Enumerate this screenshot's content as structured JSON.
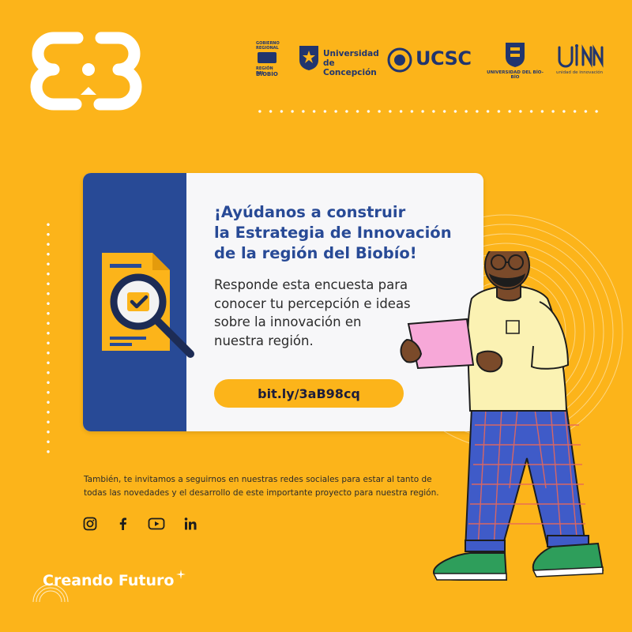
{
  "colors": {
    "background": "#FCB41A",
    "navy": "#284A96",
    "white": "#FFFFFF"
  },
  "partners": {
    "gobierno": {
      "line1": "GOBIERNO",
      "line2": "REGIONAL",
      "line3": "REGIÓN DEL",
      "line4": "BIOBÍO"
    },
    "udec": {
      "line1": "Universidad",
      "line2": "de Concepción"
    },
    "ucsc": {
      "label": "UCSC"
    },
    "ubb": {
      "label": "UNIVERSIDAD DEL BÍO-BÍO"
    },
    "uinn": {
      "label": "unidad de innovación"
    }
  },
  "card": {
    "headline_1": "¡Ayúdanos a construir",
    "headline_2": "la Estrategia de Innovación",
    "headline_3": "de la región del Biobío!",
    "body_1": "Responde esta encuesta para",
    "body_2": "conocer tu percepción e ideas",
    "body_3": "sobre la innovación en",
    "body_4": "nuestra región.",
    "link": "bit.ly/3aB98cq"
  },
  "footer": {
    "line1": "También, te invitamos a seguirnos en nuestras redes sociales para estar al tanto de",
    "line2": "todas las novedades y el desarrollo de este importante proyecto para nuestra región.",
    "social_icons": [
      "instagram-icon",
      "facebook-icon",
      "youtube-icon",
      "linkedin-icon"
    ]
  },
  "tagline": "Creando Futuro"
}
